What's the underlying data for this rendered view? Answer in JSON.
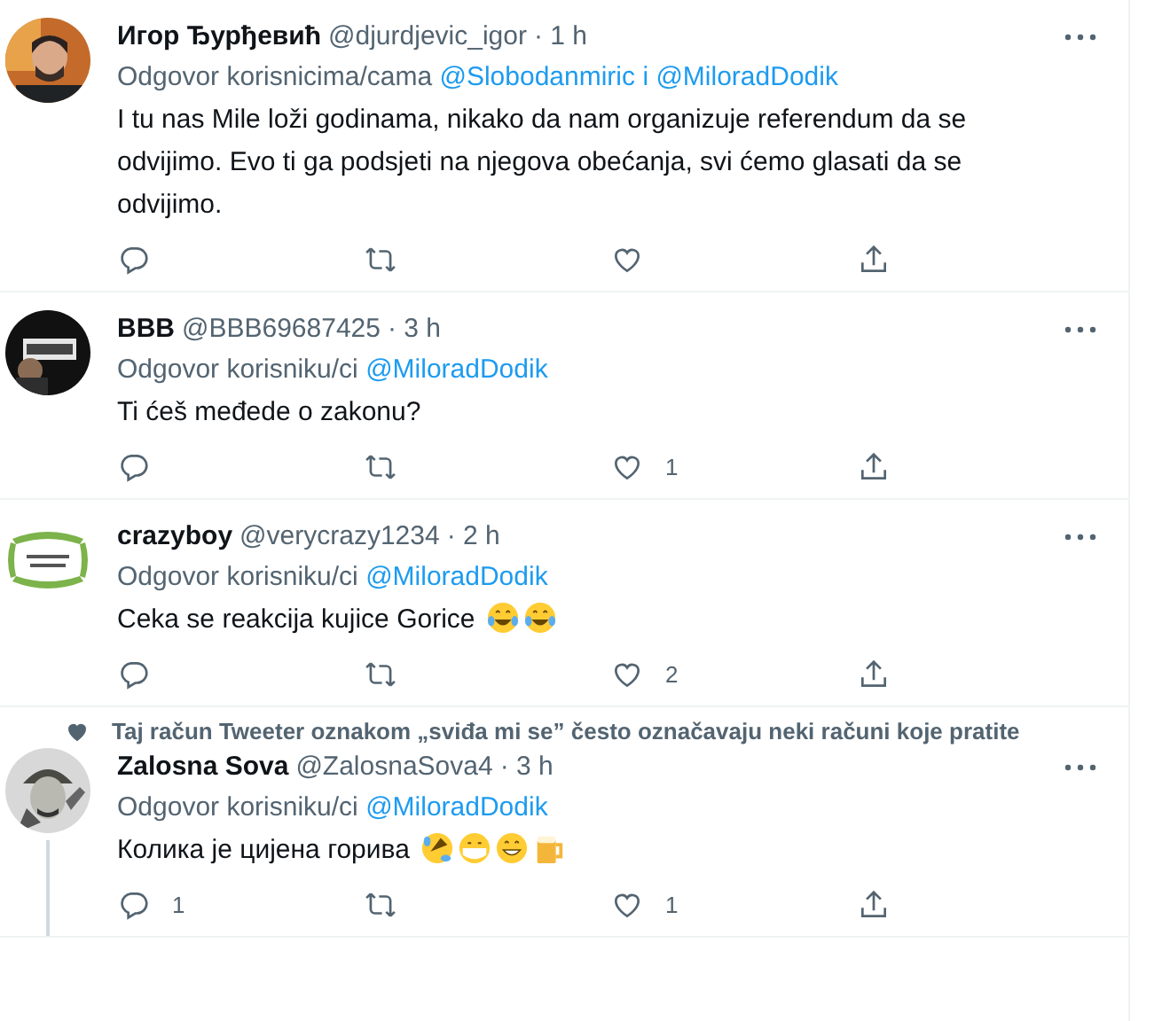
{
  "tweets": [
    {
      "name": "Игор Ђурђевић",
      "handle": "@djurdjevic_igor",
      "time": "· 1 h",
      "reply_to": {
        "prefix": "Odgovor korisnicima/cama",
        "mentions": [
          "@Slobodanmiric",
          "@MiloradDodik"
        ],
        "joiner": "i"
      },
      "text": "I tu nas Mile loži godinama, nikako da nam organizuje referendum da se odvijimo. Evo ti ga podsjeti na njegova obećanja, svi ćemo glasati da se odvijimo.",
      "thread_continues": false
    },
    {
      "name": "BBB",
      "handle": "@BBB69687425",
      "time": "· 3 h",
      "reply_to": {
        "prefix": "Odgovor korisniku/ci",
        "mentions": [
          "@MiloradDodik"
        ]
      },
      "text": "Ti ćeš međede o zakonu?",
      "thread_continues": false,
      "actions": {
        "likes": "1"
      }
    },
    {
      "name": "crazyboy",
      "handle": "@verycrazy1234",
      "time": "· 2 h",
      "reply_to": {
        "prefix": "Odgovor korisniku/ci",
        "mentions": [
          "@MiloradDodik"
        ]
      },
      "text": "Ceka se reakcija kujice Gorice",
      "emojis": [
        {
          "kind": "tears-of-joy"
        },
        {
          "kind": "tears-of-joy"
        }
      ],
      "thread_continues": false,
      "actions": {
        "likes": "2"
      }
    },
    {
      "social_context": "Taj račun Tweeter oznakom „sviđa mi se” često označavaju neki računi koje pratite",
      "name": "Zalosna Sova",
      "handle": "@ZalosnaSova4",
      "time": "· 3 h",
      "reply_to": {
        "prefix": "Odgovor korisniku/ci",
        "mentions": [
          "@MiloradDodik"
        ]
      },
      "text": "Колика је цијена горива",
      "emojis": [
        {
          "kind": "rofl"
        },
        {
          "kind": "mask"
        },
        {
          "kind": "grin"
        },
        {
          "kind": "beer"
        }
      ],
      "thread_continues": true,
      "actions": {
        "replies": "1",
        "likes": "1"
      }
    }
  ]
}
